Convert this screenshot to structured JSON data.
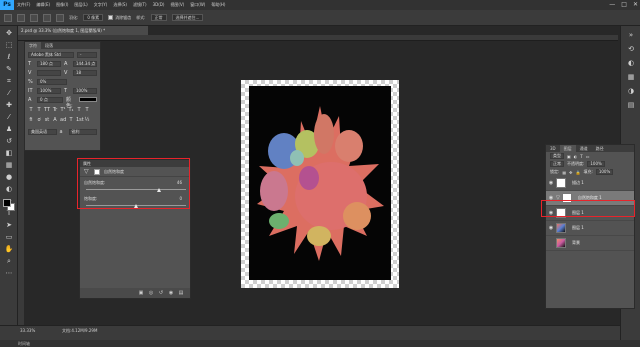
{
  "app": {
    "logo": "Ps"
  },
  "menubar": {
    "items": [
      "文件(F)",
      "编辑(E)",
      "图像(I)",
      "图层(L)",
      "文字(Y)",
      "选择(S)",
      "滤镜(T)",
      "3D(D)",
      "视图(V)",
      "窗口(W)",
      "帮助(H)"
    ],
    "minimize": "—",
    "maximize": "□",
    "close": "✕"
  },
  "options_bar": {
    "feather_label": "羽化:",
    "feather_value": "0 像素",
    "antialias_label": "消除锯齿",
    "style_label": "样式:",
    "style_value": "正常",
    "select_and_mask": "选择并遮住..."
  },
  "document": {
    "tab_title": "2.psd @ 33.3% (自然饱和度 1, 图层蒙版/8) *",
    "zoom": "33.33%",
    "doc_size": "文档:4.12M/9.29M"
  },
  "character_panel": {
    "tabs": [
      "字符",
      "段落"
    ],
    "font_family": "Adobe 黑体 Std",
    "font_style": "-",
    "font_size": "180 点",
    "leading": "144.34 点",
    "kerning": "",
    "tracking": "18",
    "scale_label": "0%",
    "vertical_scale": "100%",
    "horizontal_scale": "100%",
    "baseline": "0 点",
    "color_label": "颜色:",
    "style_buttons": [
      "T",
      "T",
      "TT",
      "Tr",
      "T¹",
      "T₁",
      "T",
      "T"
    ],
    "ot_buttons": [
      "fi",
      "ơ",
      "st",
      "A",
      "ad",
      "T",
      "1st",
      "½"
    ],
    "language": "美国英语",
    "aa_label": "a",
    "aa_value": "锐利"
  },
  "properties_panel": {
    "title": "属性",
    "adjustment_name": "自然饱和度",
    "vibrance_label": "自然饱和度:",
    "vibrance_value": 46,
    "saturation_label": "饱和度:",
    "saturation_value": 0,
    "footer_icons": [
      "clip-icon",
      "view-previous-icon",
      "reset-icon",
      "visibility-icon",
      "delete-icon"
    ]
  },
  "layers_panel": {
    "tabs": [
      "3D",
      "图层",
      "通道",
      "路径"
    ],
    "kind_label": "类型",
    "blend_mode": "正常",
    "opacity_label": "不透明度:",
    "opacity_value": "100%",
    "lock_label": "锁定:",
    "fill_label": "填充:",
    "fill_value": "100%",
    "layers": [
      {
        "name": "描边 1",
        "visible": true,
        "selected": false,
        "thumb": "white"
      },
      {
        "name": "自然饱和度 1",
        "visible": true,
        "selected": true,
        "thumb": "adjust"
      },
      {
        "name": "图层 1",
        "visible": true,
        "selected": false,
        "thumb": "white"
      },
      {
        "name": "图层 1",
        "visible": true,
        "selected": false,
        "thumb": "photo"
      },
      {
        "name": "背景",
        "visible": true,
        "selected": false,
        "thumb": "photo"
      }
    ]
  },
  "bottom_tab": "时间轴",
  "colors": {
    "highlight": "#e8242b",
    "ps_blue": "#31a8ff"
  }
}
